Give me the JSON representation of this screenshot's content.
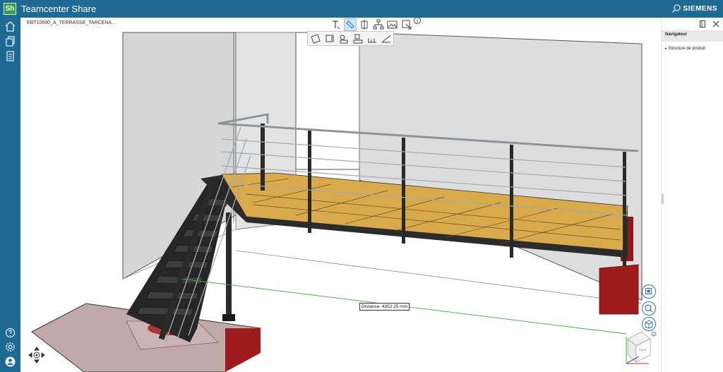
{
  "app": {
    "title": "Teamcenter Share",
    "logo_text": "Sh",
    "brand": "SIEMENS"
  },
  "document": {
    "title": "EBT10690_A_TERRASSE_TARCENA..."
  },
  "navigator": {
    "title": "Navigateur",
    "tree_item": "Structure de produit"
  },
  "measurement": {
    "label": "Distance: 4352.25 mm"
  },
  "view_cube": {
    "face_label": "FACE"
  },
  "colors": {
    "header_blue": "#1f6a93",
    "accent": "#2a74a8",
    "deck_wood": "#d8aa4c",
    "steel": "#2c2c2c",
    "wall_grey": "#d9d9d9",
    "base_red": "#9e1b1b"
  }
}
